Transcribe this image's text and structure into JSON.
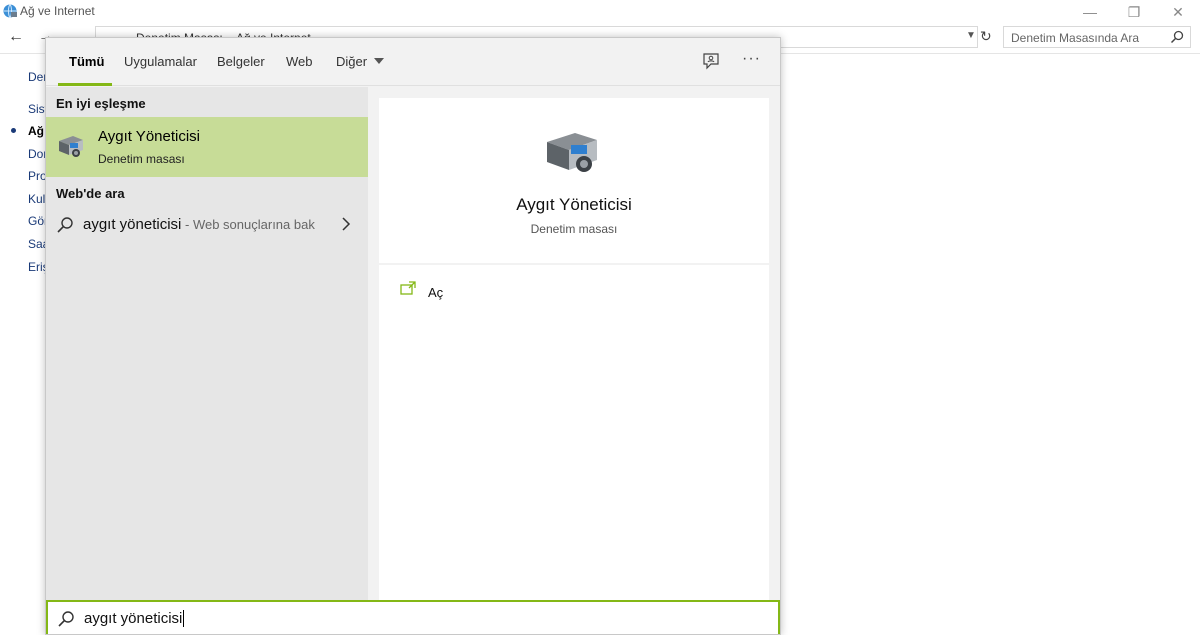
{
  "window": {
    "title": "Ağ ve Internet",
    "minimize_glyph": "—",
    "restore_glyph": "❐",
    "close_glyph": "✕",
    "address_crumbs": [
      "Denetim Masası",
      "Ağ ve Internet"
    ],
    "search_placeholder": "Denetim Masasında Ara",
    "left_nav_items": [
      "Der",
      "Sist",
      "Ağ",
      "Dor",
      "Pro",
      "Kull",
      "Gör",
      "Saa",
      "Eriş"
    ]
  },
  "search_flyout": {
    "tabs": [
      {
        "label": "Tümü",
        "active": true
      },
      {
        "label": "Uygulamalar",
        "active": false
      },
      {
        "label": "Belgeler",
        "active": false
      },
      {
        "label": "Web",
        "active": false
      },
      {
        "label": "Diğer",
        "active": false,
        "has_dropdown": true
      }
    ],
    "more_glyph": "···",
    "best_match_heading": "En iyi eşleşme",
    "best_match": {
      "title": "Aygıt Yöneticisi",
      "subtitle": "Denetim masası",
      "icon": "device-manager-icon"
    },
    "web_heading": "Web'de ara",
    "web_result": {
      "query": "aygıt yöneticisi",
      "hint": " - Web sonuçlarına bak"
    },
    "detail": {
      "title": "Aygıt Yöneticisi",
      "subtitle": "Denetim masası"
    },
    "actions": [
      {
        "label": "Aç",
        "icon": "open-icon"
      }
    ],
    "search_box_value": "aygıt yöneticisi"
  },
  "colors": {
    "accent": "#84b816",
    "selected_bg": "#c7dc97"
  }
}
